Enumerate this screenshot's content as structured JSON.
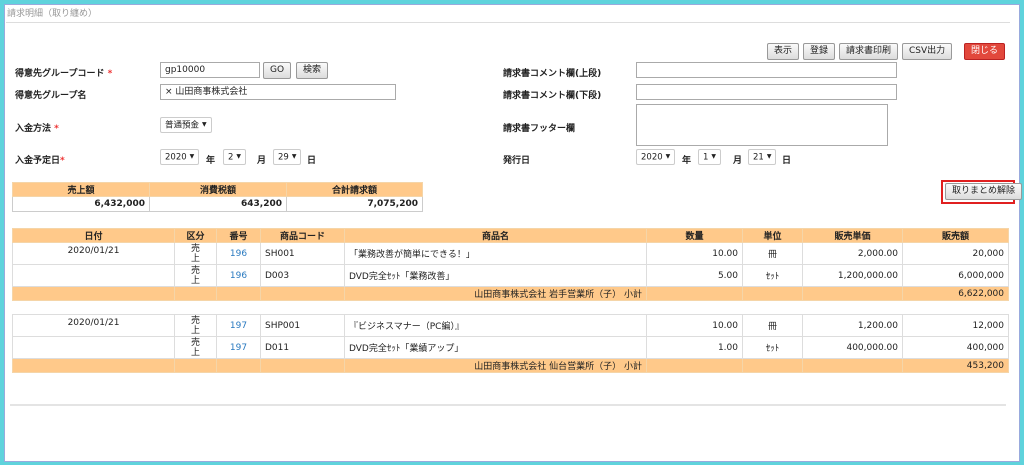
{
  "page": {
    "title": "請求明細（取り纏め）"
  },
  "toolbar": {
    "show": "表示",
    "register": "登録",
    "print": "請求書印刷",
    "csv": "CSV出力",
    "close": "閉じる"
  },
  "form": {
    "group_code": {
      "label": "得意先グループコード",
      "required": "*",
      "value": "gp10000",
      "go": "GO",
      "search": "検索"
    },
    "group_name": {
      "label": "得意先グループ名",
      "value": "× 山田商事株式会社"
    },
    "payment_method": {
      "label": "入金方法",
      "required": "*",
      "value": "普通預金"
    },
    "payment_date": {
      "label": "入金予定日",
      "required": "*",
      "year": "2020",
      "year_unit": "年",
      "month": "2",
      "month_unit": "月",
      "day": "29",
      "day_unit": "日"
    },
    "comment_upper": {
      "label": "請求書コメント欄(上段)",
      "value": ""
    },
    "comment_lower": {
      "label": "請求書コメント欄(下段)",
      "value": ""
    },
    "footer": {
      "label": "請求書フッター欄",
      "value": ""
    },
    "issue_date": {
      "label": "発行日",
      "year": "2020",
      "year_unit": "年",
      "month": "1",
      "month_unit": "月",
      "day": "21",
      "day_unit": "日"
    }
  },
  "totals": {
    "headers": [
      "売上額",
      "消費税額",
      "合計請求額"
    ],
    "values": [
      "6,432,000",
      "643,200",
      "7,075,200"
    ]
  },
  "unlink_button": "取りまとめ解除",
  "detail": {
    "headers": [
      "日付",
      "区分",
      "番号",
      "商品コード",
      "商品名",
      "数量",
      "単位",
      "販売単価",
      "販売額"
    ],
    "groups": [
      {
        "date": "2020/01/21",
        "rows": [
          {
            "kubun": "売上",
            "no": "196",
            "code": "SH001",
            "name": "「業務改善が簡単にできる！」",
            "qty": "10.00",
            "unit": "冊",
            "price": "2,000.00",
            "amount": "20,000"
          },
          {
            "kubun": "売上",
            "no": "196",
            "code": "D003",
            "name": "DVD完全ｾｯﾄ「業務改善」",
            "qty": "5.00",
            "unit": "ｾｯﾄ",
            "price": "1,200,000.00",
            "amount": "6,000,000"
          }
        ],
        "subtotal_label": "山田商事株式会社 岩手営業所（子） 小計",
        "subtotal": "6,622,000"
      },
      {
        "date": "2020/01/21",
        "rows": [
          {
            "kubun": "売上",
            "no": "197",
            "code": "SHP001",
            "name": "『ビジネスマナー（PC編）』",
            "qty": "10.00",
            "unit": "冊",
            "price": "1,200.00",
            "amount": "12,000"
          },
          {
            "kubun": "売上",
            "no": "197",
            "code": "D011",
            "name": "DVD完全ｾｯﾄ「業績アップ」",
            "qty": "1.00",
            "unit": "ｾｯﾄ",
            "price": "400,000.00",
            "amount": "400,000"
          }
        ],
        "subtotal_label": "山田商事株式会社 仙台営業所（子） 小計",
        "subtotal": "453,200"
      }
    ]
  }
}
